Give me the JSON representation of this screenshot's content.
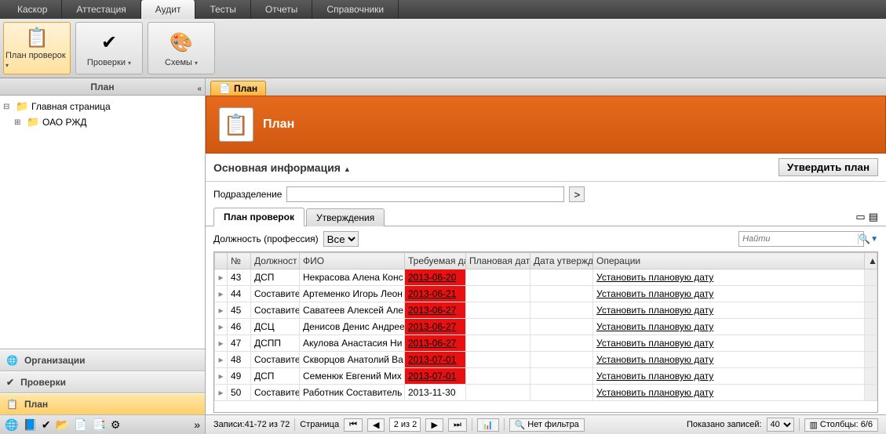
{
  "menu": {
    "items": [
      "Каскор",
      "Аттестация",
      "Аудит",
      "Тесты",
      "Отчеты",
      "Справочники"
    ],
    "active": 2
  },
  "ribbon": [
    {
      "label": "План проверок",
      "icon": "📋"
    },
    {
      "label": "Проверки",
      "icon": "✔"
    },
    {
      "label": "Схемы",
      "icon": "🎨"
    }
  ],
  "ribbon_selected": 0,
  "sidebar": {
    "title": "План",
    "tree": [
      {
        "label": "Главная страница",
        "icon": "📁",
        "exp": "⊟"
      },
      {
        "label": "ОАО РЖД",
        "icon": "📁",
        "exp": "⊞",
        "indent": 1
      }
    ],
    "panels": [
      {
        "label": "Организации",
        "icon": "🌐"
      },
      {
        "label": "Проверки",
        "icon": "✔"
      },
      {
        "label": "План",
        "icon": "📋",
        "active": true
      }
    ]
  },
  "tab": {
    "label": "План",
    "icon": "📄"
  },
  "header": {
    "title": "План",
    "icon": "📋"
  },
  "section": {
    "title": "Основная информация",
    "approve": "Утвердить план"
  },
  "filter1": {
    "label": "Подразделение",
    "value": "",
    "go": ">"
  },
  "subtabs": {
    "items": [
      "План проверок",
      "Утверждения"
    ],
    "active": 0
  },
  "filter2": {
    "label": "Должность (профессия)",
    "select": "Все",
    "search_placeholder": "Найти"
  },
  "grid": {
    "cols": [
      "№",
      "Должност",
      "ФИО",
      "Требуемая да",
      "Плановая дата",
      "Дата утвержд",
      "Операции"
    ],
    "rows": [
      {
        "num": "43",
        "pos": "ДСП",
        "fio": "Некрасова Алена Конс",
        "req": "2013-06-20",
        "red": true,
        "op": "Установить плановую дату"
      },
      {
        "num": "44",
        "pos": "Составите",
        "fio": "Артеменко Игорь Леон",
        "req": "2013-06-21",
        "red": true,
        "op": "Установить плановую дату"
      },
      {
        "num": "45",
        "pos": "Составите",
        "fio": "Саватеев Алексей Але",
        "req": "2013-06-27",
        "red": true,
        "op": "Установить плановую дату"
      },
      {
        "num": "46",
        "pos": "ДСЦ",
        "fio": "Денисов Денис Андрее",
        "req": "2013-06-27",
        "red": true,
        "op": "Установить плановую дату"
      },
      {
        "num": "47",
        "pos": "ДСПП",
        "fio": "Акулова Анастасия Ни",
        "req": "2013-06-27",
        "red": true,
        "op": "Установить плановую дату"
      },
      {
        "num": "48",
        "pos": "Составите",
        "fio": "Скворцов Анатолий Ва",
        "req": "2013-07-01",
        "red": true,
        "op": "Установить плановую дату"
      },
      {
        "num": "49",
        "pos": "ДСП",
        "fio": "Семенюк Евгений Мих",
        "req": "2013-07-01",
        "red": true,
        "op": "Установить плановую дату"
      },
      {
        "num": "50",
        "pos": "Составите",
        "fio": "Работник Составитель",
        "req": "2013-11-30",
        "red": false,
        "op": "Установить плановую дату"
      }
    ]
  },
  "pager": {
    "records": "Записи:41-72 из 72",
    "page_label": "Страница",
    "page_val": "2 из 2",
    "nofilter": "Нет фильтра",
    "shown_label": "Показано записей:",
    "shown_val": "40",
    "cols": "Столбцы: 6/6"
  }
}
